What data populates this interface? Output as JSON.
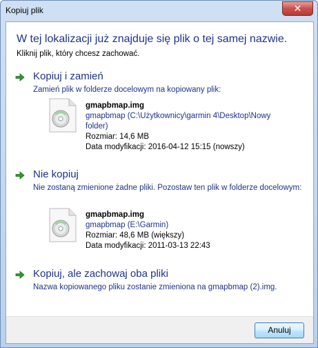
{
  "window": {
    "title": "Kopiuj plik",
    "close_glyph": "✕"
  },
  "dialog": {
    "heading": "W tej lokalizacji już znajduje się plik o tej samej nazwie.",
    "subheading": "Kliknij plik, który chcesz zachować."
  },
  "option_replace": {
    "title": "Kopiuj i zamień",
    "description": "Zamień plik w folderze docelowym na kopiowany plik:",
    "file": {
      "name": "gmapbmap.img",
      "location": "gmapbmap (C:\\Użytkownicy\\garmin 4\\Desktop\\Nowy folder)",
      "size": "Rozmiar: 14,6 MB",
      "modified": "Data modyfikacji: 2016-04-12 15:15 (nowszy)"
    }
  },
  "option_skip": {
    "title": "Nie kopiuj",
    "description": "Nie zostaną zmienione żadne pliki. Pozostaw ten plik w folderze docelowym:",
    "file": {
      "name": "gmapbmap.img",
      "location": "gmapbmap (E:\\Garmin)",
      "size": "Rozmiar: 48,6 MB (większy)",
      "modified": "Data modyfikacji: 2011-03-13 22:43"
    }
  },
  "option_keep_both": {
    "title": "Kopiuj, ale zachowaj oba pliki",
    "description": "Nazwa kopiowanego pliku zostanie zmieniona na gmapbmap (2).img."
  },
  "buttons": {
    "cancel": "Anuluj"
  },
  "icons": {
    "option_arrow": "green-arrow-icon",
    "file": "disc-file-icon"
  },
  "colors": {
    "link_blue": "#1e3287",
    "arrow_green": "#2e9a2e"
  }
}
